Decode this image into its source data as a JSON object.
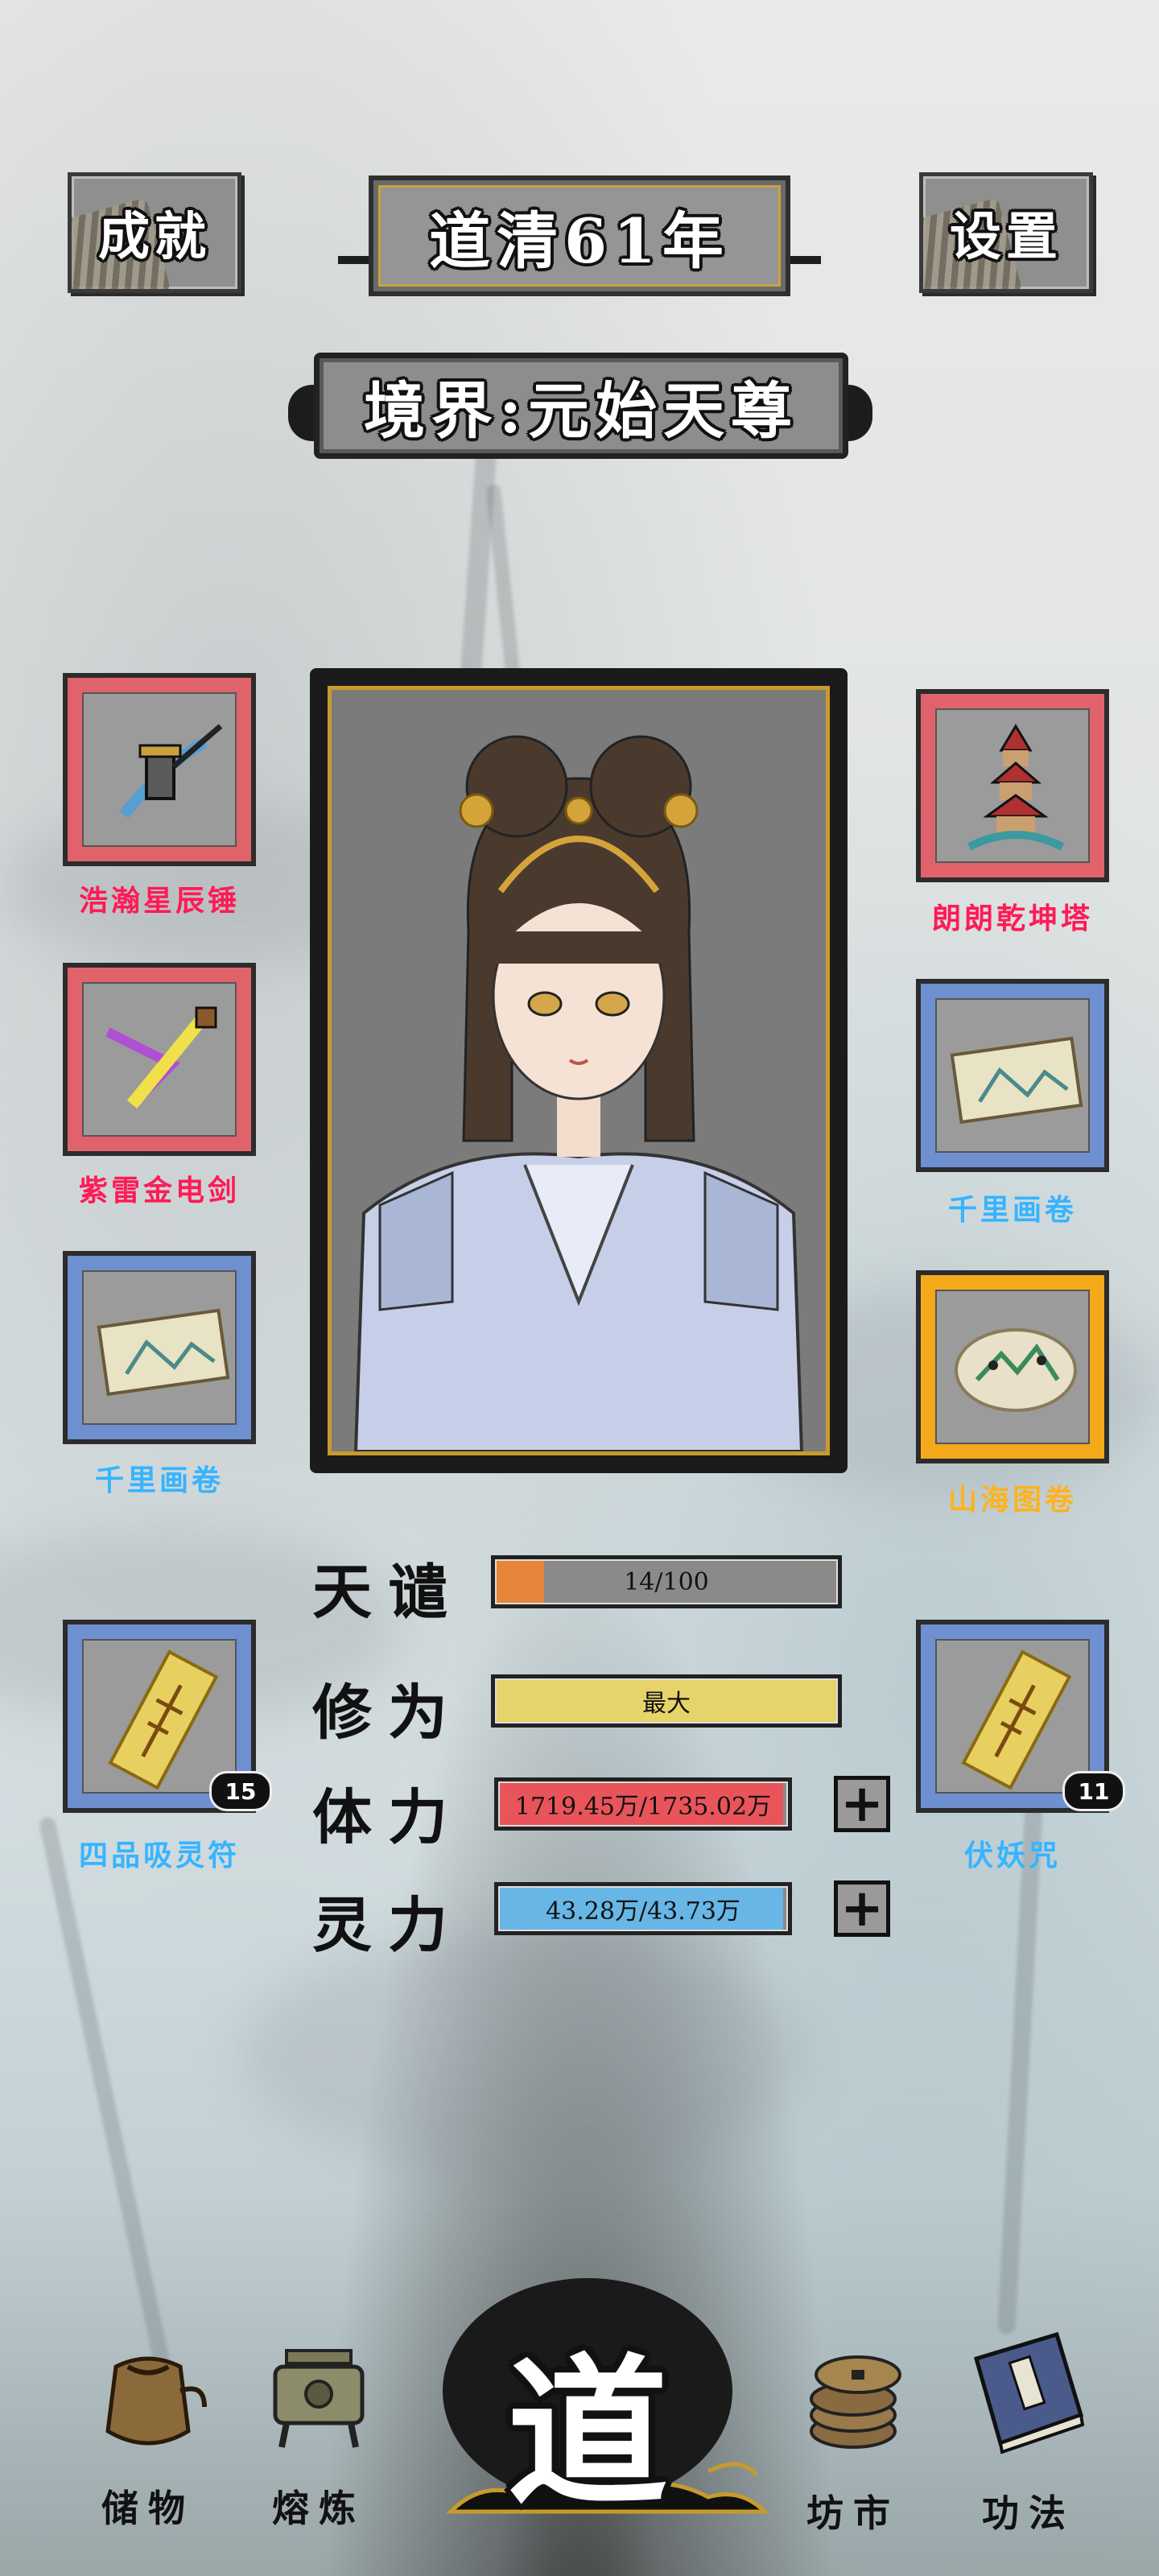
{
  "header": {
    "achievements_label": "成就",
    "settings_label": "设置",
    "era_title": "道清61年",
    "realm_title": "境界:元始天尊"
  },
  "left_items": [
    {
      "name": "浩瀚星辰锤",
      "rarity": "red",
      "icon": "hammer-icon"
    },
    {
      "name": "紫雷金电剑",
      "rarity": "red",
      "icon": "lightning-sword-icon"
    },
    {
      "name": "千里画卷",
      "rarity": "blue",
      "icon": "painting-scroll-icon"
    },
    {
      "name": "四品吸灵符",
      "rarity": "blue",
      "icon": "talisman-icon",
      "count": "15"
    }
  ],
  "right_items": [
    {
      "name": "朗朗乾坤塔",
      "rarity": "red",
      "icon": "pagoda-icon"
    },
    {
      "name": "千里画卷",
      "rarity": "blue",
      "icon": "painting-scroll-icon"
    },
    {
      "name": "山海图卷",
      "rarity": "gold",
      "icon": "mountain-sea-map-icon"
    },
    {
      "name": "伏妖咒",
      "rarity": "blue",
      "icon": "talisman-icon",
      "count": "11"
    }
  ],
  "stats": {
    "tribulation": {
      "label": "天谴",
      "text": "14/100",
      "fill": 0.14,
      "color": "#e8853a"
    },
    "cultivation": {
      "label": "修为",
      "text": "最大",
      "fill": 1.0,
      "color": "#e6d36a"
    },
    "stamina": {
      "label": "体力",
      "text": "1719.45万/1735.02万",
      "fill": 0.99,
      "color": "#e8545a"
    },
    "spirit": {
      "label": "灵力",
      "text": "43.28万/43.73万",
      "fill": 0.99,
      "color": "#67b6e6"
    }
  },
  "nav": {
    "storage": "储物",
    "smelting": "熔炼",
    "dao": "道",
    "market": "坊市",
    "techniques": "功法"
  },
  "colors": {
    "rarity_red": "#e0636b",
    "rarity_blue": "#6e8fd0",
    "rarity_gold": "#f4a91a",
    "name_red": "#ff1a56",
    "name_blue": "#36b4ff",
    "name_gold": "#ffb21c"
  }
}
